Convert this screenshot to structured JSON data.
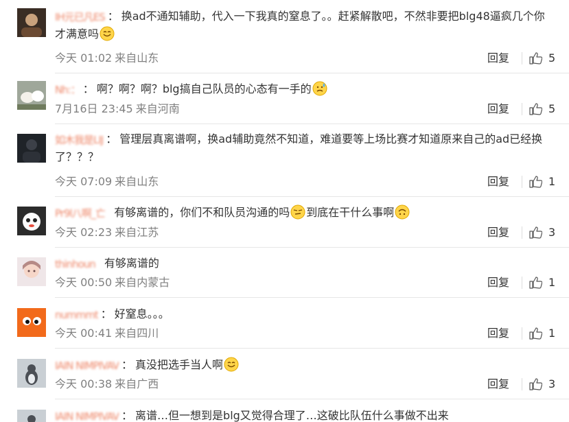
{
  "reply_label": "回复",
  "colors": {
    "username": "#eb7350",
    "meta": "#808080",
    "divider": "#e6e6e6"
  },
  "comments": [
    {
      "user": "IH元已凡ES",
      "text": "换ad不通知辅助，代入一下我真的窒息了。。赶紧解散吧，不然非要把blg48逼疯几个你才满意吗",
      "emoji": "smile",
      "time": "今天 01:02",
      "place": "来自山东",
      "likes": "5"
    },
    {
      "user": "Nh:：",
      "text": "啊？啊？啊？blg搞自己队员的心态有一手的",
      "emoji": "sweat",
      "time": "7月16日 23:45",
      "place": "来自河南",
      "likes": "5"
    },
    {
      "user": "如木我是LIJ",
      "text": "管理层真离谱啊，换ad辅助竟然不知道，难道要等上场比赛才知道原来自己的ad已经换了？？？",
      "emoji": "",
      "time": "今天 07:09",
      "place": "来自山东",
      "likes": "1"
    },
    {
      "user": "Pr9l八啊_亡",
      "text": "有够离谱的，你们不和队员沟通的吗",
      "emoji": "smirk",
      "text2": "到底在干什么事啊",
      "emoji2": "upside",
      "time": "今天 02:23",
      "place": "来自江苏",
      "likes": "3"
    },
    {
      "user": "thinhoun",
      "text": "有够离谱的",
      "emoji": "",
      "time": "今天 00:50",
      "place": "来自内蒙古",
      "likes": "1"
    },
    {
      "user": "nummmt",
      "text": "好窒息。。。",
      "emoji": "",
      "time": "今天 00:41",
      "place": "来自四川",
      "likes": "1"
    },
    {
      "user": "IAIN NIMPIVAV",
      "text": "真没把选手当人啊",
      "emoji": "smile",
      "time": "今天 00:38",
      "place": "来自广西",
      "likes": "3"
    },
    {
      "user": "IAIN NIMPIVAV",
      "text": "离谱…但一想到是blg又觉得合理了…这破比队伍什么事做不出来",
      "emoji": "",
      "time": "",
      "place": "",
      "likes": ""
    }
  ]
}
